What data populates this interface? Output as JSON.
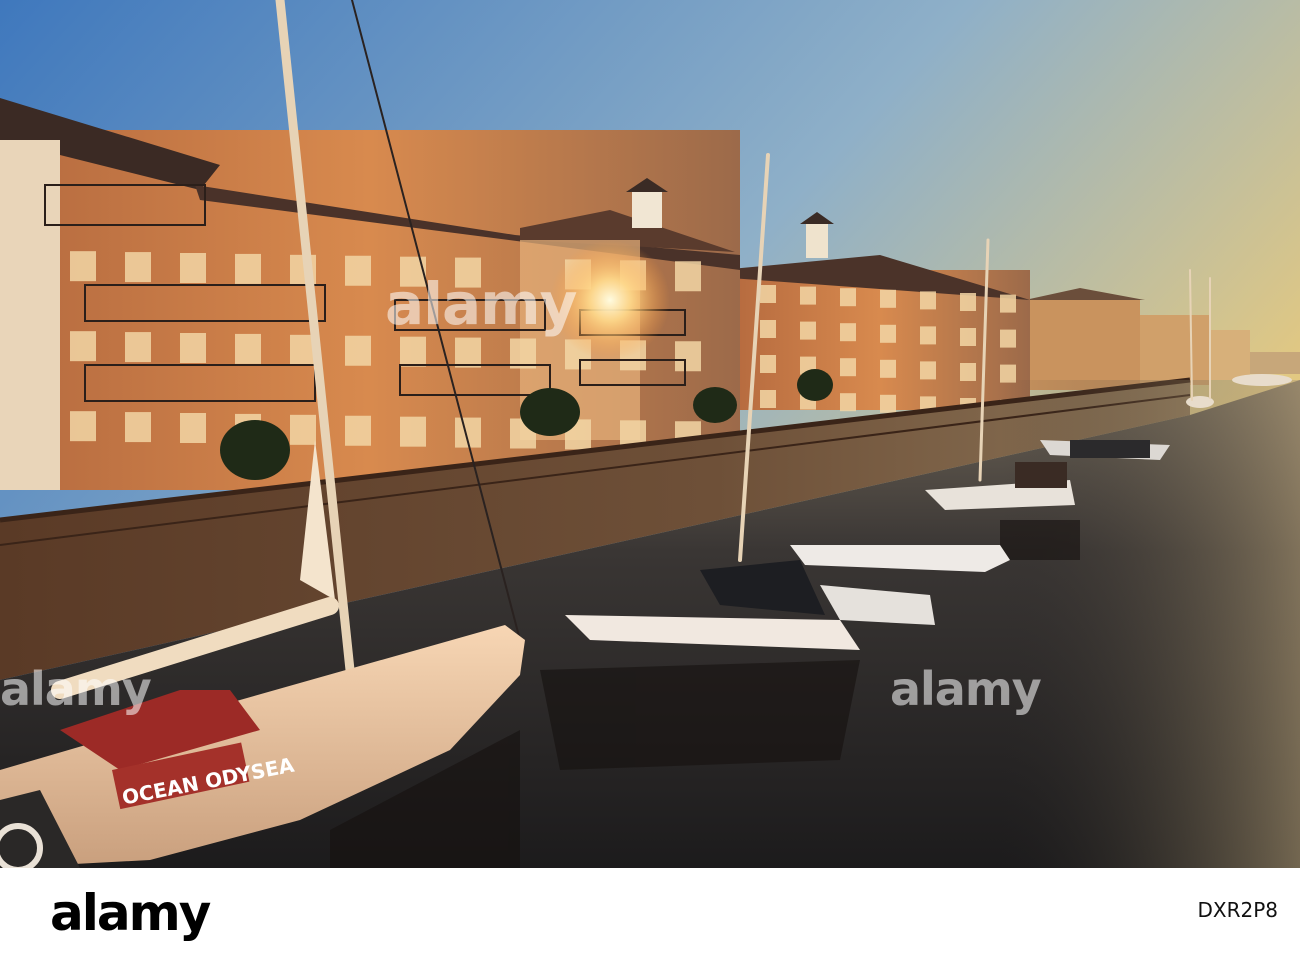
{
  "image": {
    "description_colors": {
      "sky_top": "#4f86c6",
      "sky_horizon": "#f2c76a",
      "building_brick": "#8a4a2c",
      "building_lit": "#e8a764",
      "water_dark": "#2e2b2a",
      "sun": "#fff6d0"
    }
  },
  "watermark": {
    "main": "alamy",
    "right": "alamy",
    "left": "alamy"
  },
  "boat": {
    "name": "OCEAN ODYSEA"
  },
  "footer": {
    "logo": "alamy",
    "stock_id": "DXR2P8"
  }
}
